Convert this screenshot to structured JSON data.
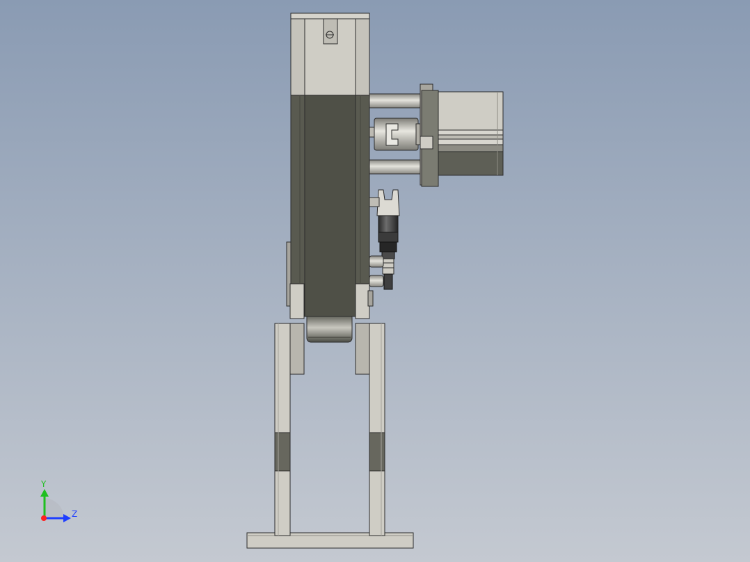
{
  "viewport": {
    "background_top": "#8a9bb3",
    "background_bottom": "#c4c9d1"
  },
  "colors": {
    "steel_light": "#cfcdc5",
    "steel_mid": "#b8b6ae",
    "steel_dark": "#9d9b94",
    "dark_body": "#595a50",
    "dark_body_shade": "#4a4b42",
    "edge": "#2b2b2b",
    "motor_body": "#60615a",
    "bracket": "#6b6c62"
  },
  "triad": {
    "y_label": "Y",
    "z_label": "Z",
    "y_color": "#1fbf1f",
    "z_color": "#1f3fff",
    "x_color": "#ff2020"
  }
}
